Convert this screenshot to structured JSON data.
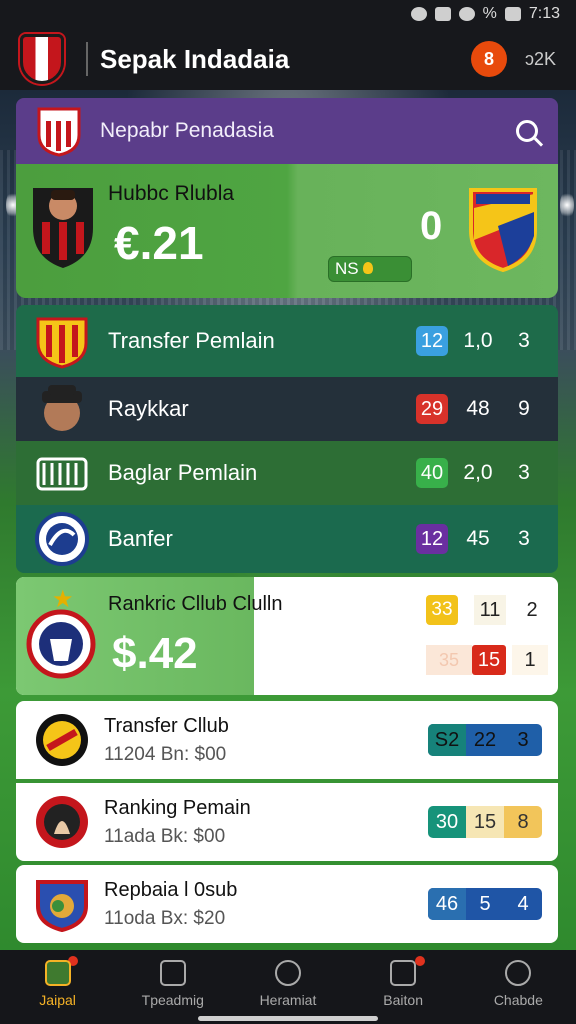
{
  "status_bar": {
    "battery_text": "%",
    "time": "7:13"
  },
  "app_bar": {
    "title": "Sepak Indadaia",
    "notification_count": "8",
    "short_label": "ɔ2K"
  },
  "search_header": {
    "title": "Nepabr Penadasia"
  },
  "match_card": {
    "home_name": "Hubbc Rlubla",
    "home_score": "€.21",
    "away_score": "0",
    "status_pill": "NS"
  },
  "rows": [
    {
      "label": "Transfer Pemlain",
      "chip": "12",
      "chip_color": "#3aa0e0",
      "v1": "1,0",
      "v2": "3"
    },
    {
      "label": "Raykkar",
      "chip": "29",
      "chip_color": "#d8322a",
      "v1": "48",
      "v2": "9"
    },
    {
      "label": "Baglar Pemlain",
      "chip": "40",
      "chip_color": "#38b04a",
      "v1": "2,0",
      "v2": "3"
    },
    {
      "label": "Banfer",
      "chip": "12",
      "chip_color": "#6a2fa0",
      "v1": "45",
      "v2": "3"
    }
  ],
  "promo_card": {
    "name": "Rankric Cllub  Clulln",
    "price": "$.42",
    "c1": "33",
    "c2": "11",
    "c3": "2",
    "c4": "35",
    "c5": "15",
    "c6": "1"
  },
  "list_cards": [
    {
      "title": "Transfer Cllub",
      "subtitle": "11204 Bn: $00",
      "s1": "S2",
      "s2": "22",
      "s3": "3"
    },
    {
      "title": "Ranking Pemain",
      "subtitle": "11ada Bk: $00",
      "s1": "30",
      "s2": "15",
      "s3": "8"
    },
    {
      "title": "Repbaia l 0sub",
      "subtitle": "11oda Bx: $20",
      "s1": "46",
      "s2": "5",
      "s3": "4"
    }
  ],
  "bottom_nav": [
    {
      "label": "Jaipal",
      "icon": "home-icon",
      "active": true
    },
    {
      "label": "Tpeadmig",
      "icon": "calendar-icon",
      "active": false
    },
    {
      "label": "Heramiat",
      "icon": "face-icon",
      "active": false
    },
    {
      "label": "Baiton",
      "icon": "inbox-icon",
      "active": false
    },
    {
      "label": "Chabde",
      "icon": "search-icon",
      "active": false
    }
  ]
}
